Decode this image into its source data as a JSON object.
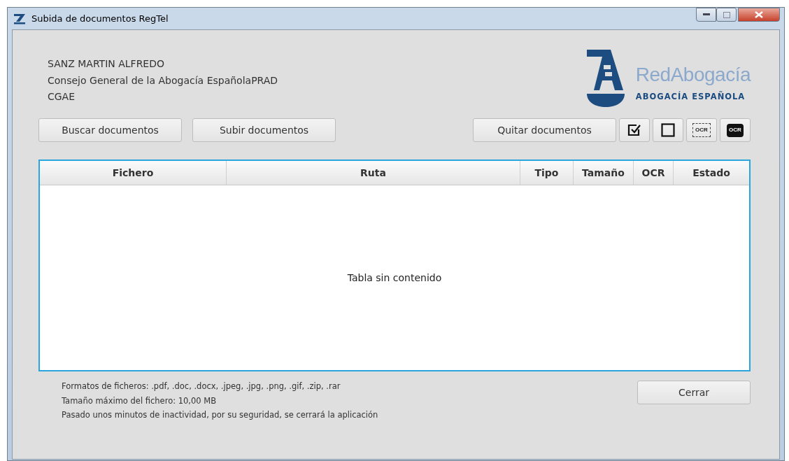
{
  "window": {
    "title": "Subida de documentos RegTel"
  },
  "user": [
    "SANZ MARTIN ALFREDO",
    "Consejo General de la Abogacía EspañolaPRAD",
    "CGAE"
  ],
  "logo": {
    "name": "RedAbogacía",
    "subtitle": "ABOGACÍA ESPAÑOLA"
  },
  "left_buttons": [
    "Buscar documentos",
    "Subir documentos"
  ],
  "remove_button": "Quitar documentos",
  "icon_buttons": [
    {
      "kind": "check-all"
    },
    {
      "kind": "uncheck-all"
    },
    {
      "kind": "ocr-outline",
      "label": "OCR"
    },
    {
      "kind": "ocr-filled",
      "label": "OCR"
    }
  ],
  "table": {
    "columns": [
      "Fichero",
      "Ruta",
      "Tipo",
      "Tamaño",
      "OCR",
      "Estado"
    ],
    "empty_message": "Tabla sin contenido"
  },
  "notes": [
    "Formatos de ficheros: .pdf, .doc, .docx, .jpeg, .jpg, .png, .gif, .zip, .rar",
    "Tamaño máximo del fichero: 10,00 MB",
    "Pasado unos minutos de inactividad, por su seguridad, se cerrará la aplicación"
  ],
  "close_button": "Cerrar"
}
